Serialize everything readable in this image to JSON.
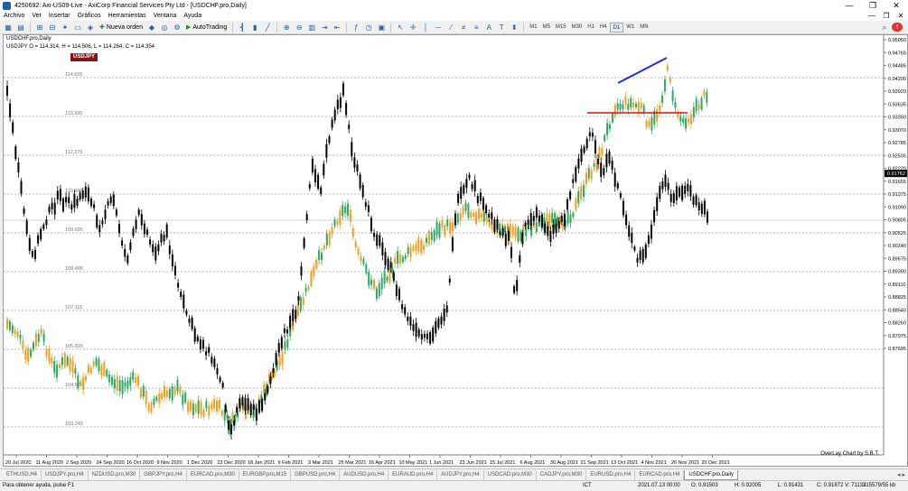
{
  "window": {
    "title": "4250692: Axi-US09-Live - AxiCorp Financial Services Pty Ltd - [USDCHF.pro,Daily]",
    "buttons": [
      "—",
      "❐",
      "✕"
    ]
  },
  "menu": {
    "items": [
      "Archivo",
      "Ver",
      "Insertar",
      "Gráficos",
      "Herramientas",
      "Ventana",
      "Ayuda"
    ],
    "doc_buttons": [
      "—",
      "❐",
      "✕"
    ]
  },
  "toolbar": {
    "new_order": "Nueva orden",
    "autotrading": "AutoTrading",
    "timeframes": [
      "M1",
      "M5",
      "M15",
      "M30",
      "H1",
      "H4",
      "D1",
      "W1",
      "MN"
    ],
    "active_timeframe": "D1"
  },
  "chart": {
    "info_line1": "USDCHF.pro,Daily",
    "info_line2": "USDJPY O = 114.314, H = 114.506, L = 114.264, C = 114.354",
    "overlay_badge": "USDJPY",
    "credit": "OverLay Chart by S.B.T.",
    "price_labels": [
      "0.95050",
      "0.94765",
      "0.94485",
      "0.94200",
      "0.93920",
      "0.93635",
      "0.93350",
      "0.93070",
      "0.92785",
      "0.92505",
      "0.92220",
      "0.91655",
      "0.91375",
      "0.91090",
      "0.90805",
      "0.90525",
      "0.90240",
      "0.89675",
      "0.89390",
      "0.89110",
      "0.88825",
      "0.88540",
      "0.88260",
      "0.87975",
      "0.87695"
    ],
    "current_price": "0.91762",
    "overlay_levels": [
      "114.655",
      "113.995",
      "112.275",
      "110.985",
      "109.695",
      "108.405",
      "107.115",
      "105.825",
      "104.535",
      "103.245"
    ],
    "dates": [
      "20 Jul 2020",
      "11 Aug 2020",
      "2 Sep 2020",
      "24 Sep 2020",
      "16 Oct 2020",
      "9 Nov 2020",
      "1 Dec 2020",
      "23 Dec 2020",
      "18 Jan 2021",
      "9 Feb 2021",
      "3 Mar 2021",
      "25 Mar 2021",
      "16 Apr 2021",
      "10 May 2021",
      "1 Jun 2021",
      "23 Jun 2021",
      "15 Jul 2021",
      "6 Aug 2021",
      "30 Aug 2021",
      "21 Sep 2021",
      "13 Oct 2021",
      "4 Nov 2021",
      "26 Nov 2021",
      "20 Dec 2021"
    ],
    "colors": {
      "usdchf_candles": "#000000",
      "overlay_bull": "#2ea863",
      "overlay_bear": "#f0a020",
      "trendline": "#1e2ee6",
      "resistance": "#e01010",
      "grid": "#a0a0a0"
    }
  },
  "tabs": {
    "items": [
      "ETHUSD,H4",
      "USDJPY.pro,H4",
      "NZDUSD.pro,M30",
      "GBPJPY.pro,H4",
      "EURCAD.pro,M30",
      "EURGBP.pro,M15",
      "GBPUSD.pro,H4",
      "AUDUSD.pro,H4",
      "EURAUD.pro,H4",
      "AUDJPY.pro,H4",
      "USDCAD.pro,M30",
      "CADJPY.pro,M30",
      "EURUSD.pro,H4",
      "EURCAD.pro,H4",
      "USDCHF.pro,Daily"
    ],
    "active_index": 14,
    "nav": "◂ ▸"
  },
  "status": {
    "help": "Para obtener ayuda, pulse F1",
    "ict": "ICT",
    "datetime": "2021.07.13 00:00",
    "open": "O: 0.91503",
    "high": "H: 0.92005",
    "low": "L: 0.91431",
    "close": "C: 0.91872",
    "volume": "V: 71133",
    "traffic": "215579/55 kb"
  }
}
